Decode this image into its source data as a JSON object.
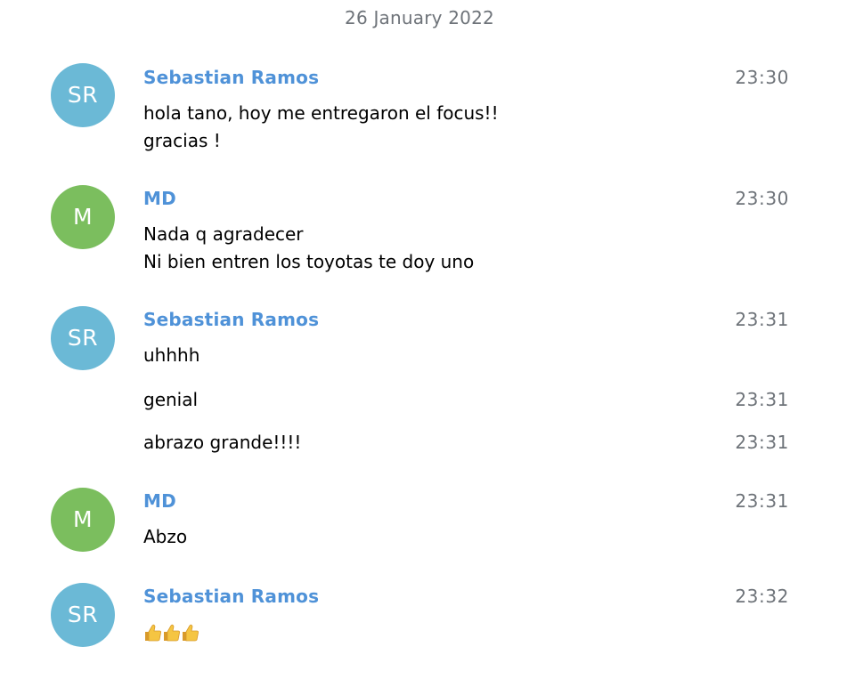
{
  "date_header": "26 January 2022",
  "colors": {
    "avatar_sr": "#6bb9d6",
    "avatar_m": "#7bbe5e",
    "sender_name": "#4f92d8",
    "timestamp": "#6e7379"
  },
  "messages": [
    {
      "avatar": "SR",
      "sender": "Sebastian Ramos",
      "time": "23:30",
      "lines": [
        "hola tano, hoy me entregaron el focus!!",
        "gracias !"
      ]
    },
    {
      "avatar": "M",
      "sender": "MD",
      "time": "23:30",
      "lines": [
        "Nada q agradecer",
        "Ni bien entren los toyotas te doy uno"
      ]
    },
    {
      "avatar": "SR",
      "sender": "Sebastian Ramos",
      "time": "23:31",
      "lines": [
        "uhhhh"
      ]
    },
    {
      "text": "genial",
      "time": "23:31"
    },
    {
      "text": "abrazo grande!!!!",
      "time": "23:31"
    },
    {
      "avatar": "M",
      "sender": "MD",
      "time": "23:31",
      "lines": [
        "Abzo"
      ]
    },
    {
      "avatar": "SR",
      "sender": "Sebastian Ramos",
      "time": "23:32",
      "emoji": [
        "thumbs-up-icon",
        "thumbs-up-icon",
        "thumbs-up-icon"
      ]
    }
  ]
}
